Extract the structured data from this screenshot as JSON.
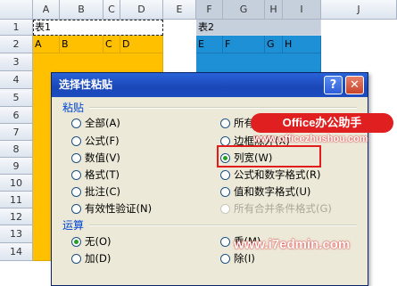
{
  "spreadsheet": {
    "columns": [
      "A",
      "B",
      "C",
      "D",
      "E",
      "F",
      "G",
      "H",
      "I",
      "J"
    ],
    "rows": [
      "1",
      "2",
      "3",
      "4",
      "5",
      "6",
      "7",
      "8",
      "9",
      "10",
      "11",
      "12",
      "13",
      "14"
    ],
    "table1": {
      "title": "表1",
      "headers": [
        "A",
        "B",
        "C",
        "D"
      ]
    },
    "table2": {
      "title": "表2",
      "headers": [
        "E",
        "F",
        "G",
        "H"
      ]
    },
    "colors": {
      "orange": "#ffc000",
      "blue": "#1e90d6"
    }
  },
  "dialog": {
    "title": "选择性粘贴",
    "help_label": "?",
    "close_label": "✕",
    "paste_group": "粘贴",
    "paste_left": [
      "全部(A)",
      "公式(F)",
      "数值(V)",
      "格式(T)",
      "批注(C)",
      "有效性验证(N)"
    ],
    "paste_right": [
      "所有",
      "边框除外(X)",
      "列宽(W)",
      "公式和数字格式(R)",
      "值和数字格式(U)",
      "所有合并条件格式(G)"
    ],
    "selected_paste": "列宽(W)",
    "operation_group": "运算",
    "operation_left": [
      "无(O)",
      "加(D)"
    ],
    "operation_right": [
      "乘(M)",
      "除(I)"
    ],
    "selected_operation": "无(O)"
  },
  "watermarks": {
    "badge": "Office办公助手",
    "site1": "www.officezhushou.com",
    "site2": "www.i7edmin.com"
  }
}
